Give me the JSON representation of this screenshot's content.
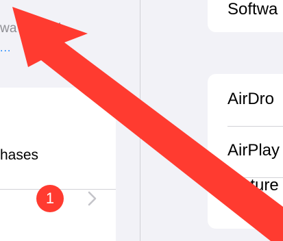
{
  "left": {
    "account_subtitle": "wa School",
    "account_link": "...",
    "purchases_label": "hases",
    "badge_count": "1"
  },
  "right": {
    "top_row": "Softwa",
    "rows": [
      "AirDro",
      "AirPlay",
      "Picture"
    ]
  },
  "annotation": {
    "type": "arrow",
    "color": "#ff3b30",
    "direction": "up-left"
  },
  "colors": {
    "background": "#f2f2f7",
    "card": "#ffffff",
    "link": "#007aff",
    "badge": "#ff3b30",
    "secondary_text": "#8e8e93"
  }
}
